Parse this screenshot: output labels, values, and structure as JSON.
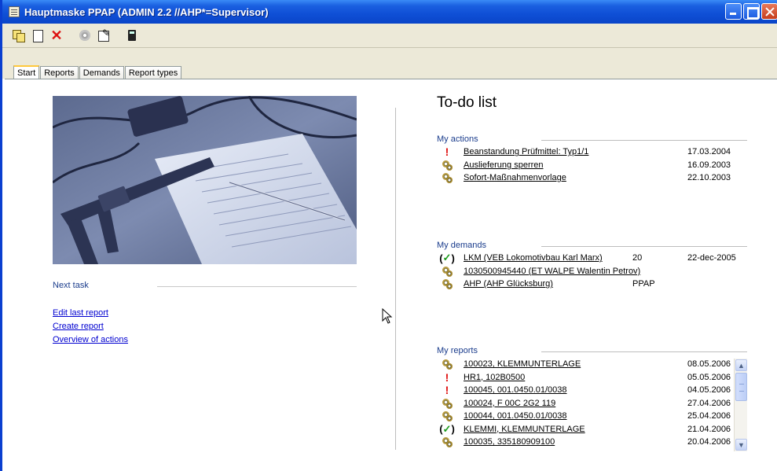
{
  "window": {
    "title": "Hauptmaske PPAP (ADMIN 2.2 //AHP*=Supervisor)"
  },
  "toolbar": {
    "icons": [
      "copy-icon",
      "new-document-icon",
      "delete-icon",
      "disk-icon",
      "edit-icon",
      "calculator-icon"
    ]
  },
  "tabs": [
    {
      "label": "Start",
      "active": true
    },
    {
      "label": "Reports",
      "active": false
    },
    {
      "label": "Demands",
      "active": false
    },
    {
      "label": "Report types",
      "active": false
    }
  ],
  "start": {
    "next_task_label": "Next task",
    "links": [
      "Edit last report",
      "Create report",
      "Overview of actions"
    ]
  },
  "todo": {
    "title": "To-do list",
    "my_actions": {
      "title": "My actions",
      "items": [
        {
          "icon": "exclamation-icon",
          "label": "Beanstandung Prüfmittel: Typ1/1",
          "date": "17.03.2004"
        },
        {
          "icon": "gears-icon",
          "label": "Auslieferung sperren",
          "date": "16.09.2003"
        },
        {
          "icon": "gears-icon",
          "label": "Sofort-Maßnahmenvorlage",
          "date": "22.10.2003"
        }
      ]
    },
    "my_demands": {
      "title": "My demands",
      "items": [
        {
          "icon": "check-icon",
          "label": "LKM (VEB Lokomotivbau Karl Marx)",
          "value": "20",
          "date": "22-dec-2005"
        },
        {
          "icon": "gears-icon",
          "label": "1030500945440 (ET WALPE Walentin Petrov)",
          "value": "",
          "date": ""
        },
        {
          "icon": "gears-icon",
          "label": "AHP (AHP Glücksburg)",
          "value": "PPAP",
          "date": ""
        }
      ]
    },
    "my_reports": {
      "title": "My reports",
      "items": [
        {
          "icon": "gears-icon",
          "label": "100023, KLEMMUNTERLAGE",
          "date": "08.05.2006"
        },
        {
          "icon": "exclamation-icon",
          "label": "HR1, 102B0500",
          "date": "05.05.2006"
        },
        {
          "icon": "exclamation-icon",
          "label": "100045, 001.0450.01/0038",
          "date": "04.05.2006"
        },
        {
          "icon": "gears-icon",
          "label": "100024, F 00C 2G2 119",
          "date": "27.04.2006"
        },
        {
          "icon": "gears-icon",
          "label": "100044, 001.0450.01/0038",
          "date": "25.04.2006"
        },
        {
          "icon": "check-icon",
          "label": "KLEMMI, KLEMMUNTERLAGE",
          "date": "21.04.2006"
        },
        {
          "icon": "gears-icon",
          "label": "100035, 335180909100",
          "date": "20.04.2006"
        }
      ]
    }
  },
  "colors": {
    "titlebar": "#0f4fd6",
    "section_title": "#1a3c8c",
    "link": "#0000d0",
    "alert": "#e01010",
    "check": "#1a9a1a"
  }
}
